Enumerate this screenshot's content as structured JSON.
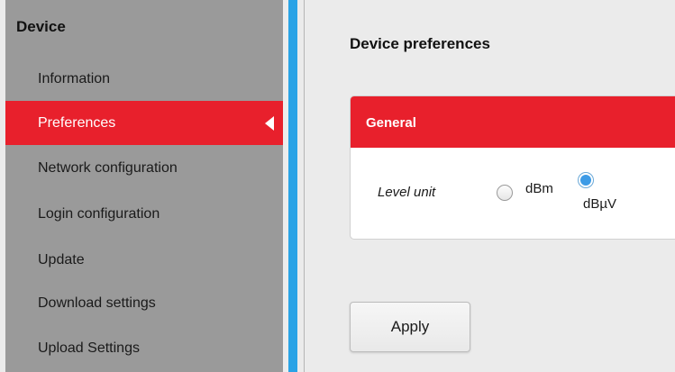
{
  "sidebar": {
    "header": "Device",
    "items": [
      {
        "label": "Information",
        "name": "sidebar-item-information",
        "active": false
      },
      {
        "label": "Preferences",
        "name": "sidebar-item-preferences",
        "active": true
      },
      {
        "label": "Network configuration",
        "name": "sidebar-item-network-configuration",
        "active": false
      },
      {
        "label": "Login configuration",
        "name": "sidebar-item-login-configuration",
        "active": false
      },
      {
        "label": "Update",
        "name": "sidebar-item-update",
        "active": false
      },
      {
        "label": "Download settings",
        "name": "sidebar-item-download-settings",
        "active": false
      },
      {
        "label": "Upload Settings",
        "name": "sidebar-item-upload-settings",
        "active": false
      }
    ]
  },
  "main": {
    "title": "Device preferences",
    "panel": {
      "header": "General",
      "field_label": "Level unit",
      "options": [
        {
          "label": "dBm",
          "checked": false
        },
        {
          "label": "dBµV",
          "checked": true
        }
      ]
    },
    "apply_label": "Apply"
  },
  "colors": {
    "accent_red": "#e8202c",
    "accent_blue": "#29a3e6",
    "sidebar_bg": "#9a9a9a",
    "radio_selected": "#3d9be6"
  }
}
